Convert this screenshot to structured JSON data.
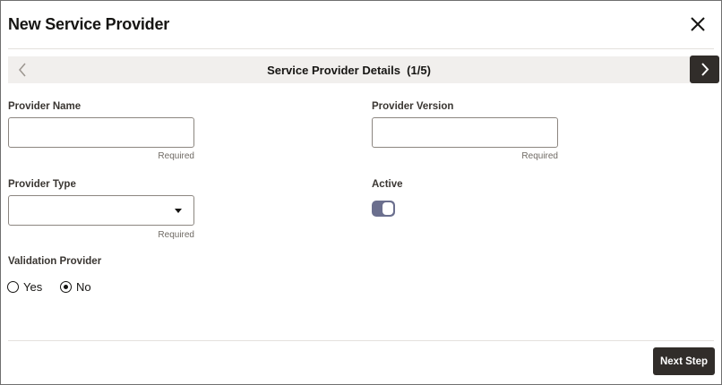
{
  "dialog": {
    "title": "New Service Provider",
    "close_icon": "close-icon"
  },
  "train": {
    "step_title": "Service Provider Details  (1/5)",
    "prev_icon": "chevron-left-icon",
    "next_icon": "chevron-right-icon"
  },
  "form": {
    "provider_name": {
      "label": "Provider Name",
      "value": "",
      "hint": "Required"
    },
    "provider_version": {
      "label": "Provider Version",
      "value": "",
      "hint": "Required"
    },
    "provider_type": {
      "label": "Provider Type",
      "value": "",
      "hint": "Required",
      "icon": "caret-down-icon"
    },
    "active": {
      "label": "Active",
      "on": true
    },
    "validation_provider": {
      "label": "Validation Provider",
      "options": [
        {
          "label": "Yes",
          "selected": false
        },
        {
          "label": "No",
          "selected": true
        }
      ]
    }
  },
  "footer": {
    "next_step_label": "Next Step"
  },
  "colors": {
    "primary": "#312d2a",
    "toggle_on": "#6b6f8e",
    "step_bar_bg": "#f1efed"
  }
}
